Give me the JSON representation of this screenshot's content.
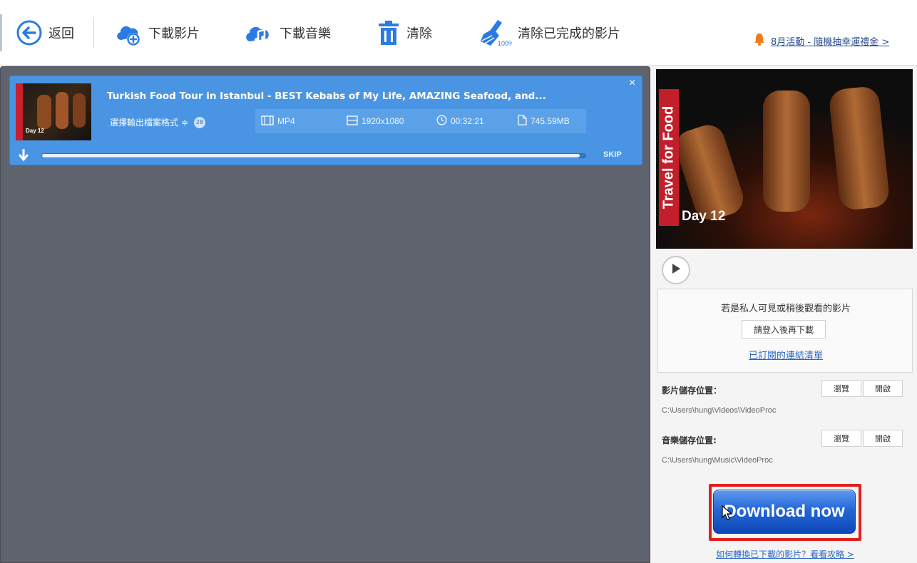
{
  "toolbar": {
    "back_label": "返回",
    "download_video_label": "下載影片",
    "download_music_label": "下載音樂",
    "clear_label": "清除",
    "clear_completed_label": "清除已完成的影片",
    "promo_label": "8月活動 - 隨機抽幸運禮金 >"
  },
  "task": {
    "title": "Turkish Food Tour in Istanbul - BEST Kebabs of My Life, AMAZING Seafood, and...",
    "format_select_label": "選擇輸出檔案格式 ≑",
    "format_count": "28",
    "format": "MP4",
    "resolution": "1920x1080",
    "duration": "00:32:21",
    "size": "745.59MB",
    "close_symbol": "×",
    "skip_label": "SKIP",
    "progress_percent": 99,
    "thumb_label": "Day 12"
  },
  "preview": {
    "side_text": "Travel for Food",
    "day_text": "Day 12"
  },
  "info": {
    "private_text": "若是私人可見或稍後觀看的影片",
    "login_button": "請登入後再下載",
    "subscribed_link": "已訂閱的連結清單"
  },
  "paths": {
    "video_label": "影片儲存位置：",
    "video_path": "C:\\Users\\hung\\Videos\\VideoProc",
    "music_label": "音樂儲存位置:",
    "music_path": "C:\\Users\\hung\\Music\\VideoProc",
    "browse_label": "瀏覽",
    "open_label": "開啟"
  },
  "download_now_label": "Download now",
  "guide_link": "如何轉換已下載的影片？看看攻略 >",
  "colors": {
    "accent": "#4a95e3",
    "work_bg": "#5f636d",
    "highlight": "#e21e1e",
    "link": "#2a66c7"
  },
  "icons": [
    "back-arrow-icon",
    "cloud-download-video-icon",
    "cloud-download-music-icon",
    "trash-icon",
    "broom-icon",
    "bell-icon",
    "film-icon",
    "resolution-icon",
    "clock-icon",
    "file-icon",
    "download-arrow-icon",
    "play-icon",
    "mouse-cursor-icon"
  ]
}
